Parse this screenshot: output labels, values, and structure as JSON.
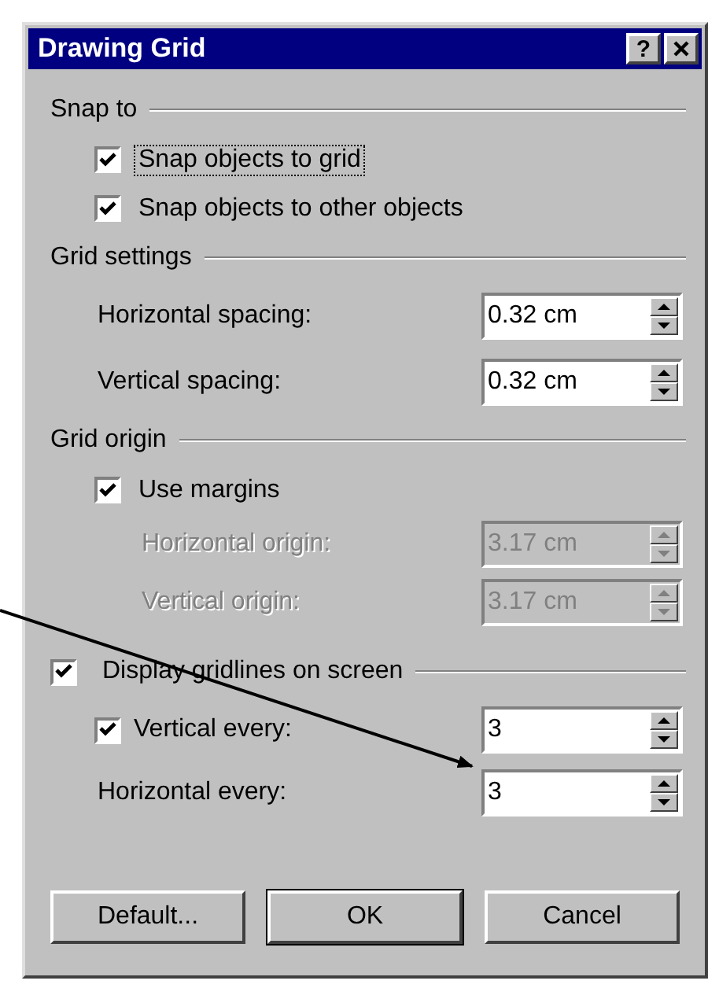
{
  "window": {
    "title": "Drawing Grid",
    "help": "?"
  },
  "sections": [
    {
      "kind": "text",
      "title": "Snap to",
      "items": [
        {
          "kind": "checkbox",
          "label": "Snap objects to grid",
          "checked": true,
          "focused": true
        },
        {
          "kind": "checkbox",
          "label": "Snap objects to other objects",
          "checked": true,
          "focused": false
        }
      ]
    },
    {
      "kind": "text",
      "title": "Grid settings",
      "items": [
        {
          "kind": "spin",
          "label": "Horizontal spacing:",
          "value": "0.32 cm",
          "disabled": false
        },
        {
          "kind": "spin",
          "label": "Vertical spacing:",
          "value": "0.32 cm",
          "disabled": false
        }
      ]
    },
    {
      "kind": "text",
      "title": "Grid origin",
      "items": [
        {
          "kind": "checkbox",
          "label": "Use margins",
          "checked": true,
          "focused": false
        },
        {
          "kind": "spin",
          "label": "Horizontal origin:",
          "value": "3.17 cm",
          "disabled": true
        },
        {
          "kind": "spin",
          "label": "Vertical origin:",
          "value": "3.17 cm",
          "disabled": true
        }
      ]
    },
    {
      "kind": "checkbox",
      "title": "Display gridlines on screen",
      "checked": true,
      "items": [
        {
          "kind": "checkspin",
          "label": "Vertical every:",
          "value": "3",
          "checked": true
        },
        {
          "kind": "spin",
          "label": "Horizontal every:",
          "value": "3",
          "disabled": false
        }
      ]
    }
  ],
  "buttons": [
    {
      "label": "Default...",
      "default": false
    },
    {
      "label": "OK",
      "default": true
    },
    {
      "label": "Cancel",
      "default": false
    }
  ]
}
